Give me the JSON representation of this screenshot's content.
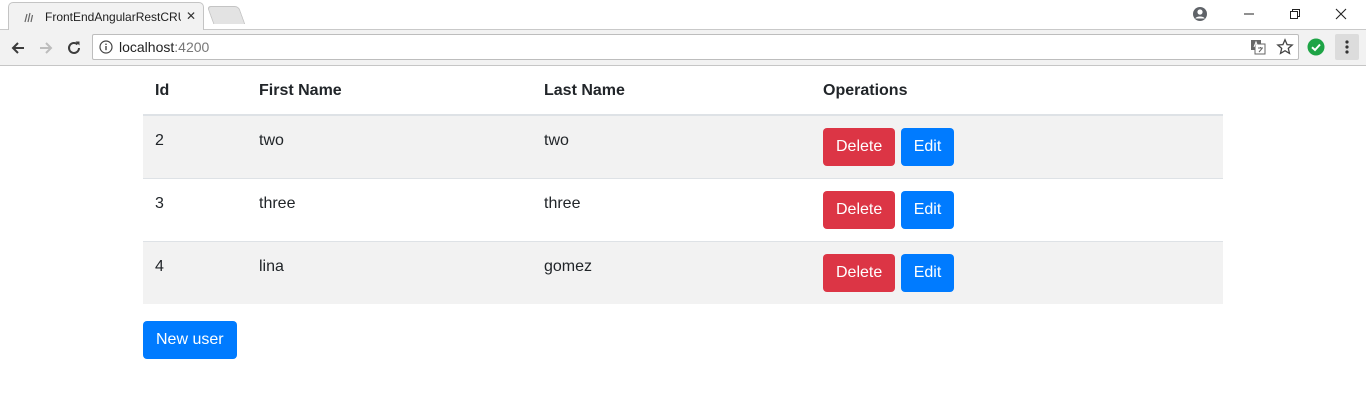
{
  "browser": {
    "tab_title": "FrontEndAngularRestCRUD",
    "tab_close": "✕",
    "url_host": "localhost",
    "url_port": ":4200"
  },
  "table": {
    "headers": {
      "id": "Id",
      "first_name": "First Name",
      "last_name": "Last Name",
      "operations": "Operations"
    },
    "rows": [
      {
        "id": "2",
        "first_name": "two",
        "last_name": "two",
        "delete_label": "Delete",
        "edit_label": "Edit"
      },
      {
        "id": "3",
        "first_name": "three",
        "last_name": "three",
        "delete_label": "Delete",
        "edit_label": "Edit"
      },
      {
        "id": "4",
        "first_name": "lina",
        "last_name": "gomez",
        "delete_label": "Delete",
        "edit_label": "Edit"
      }
    ]
  },
  "actions": {
    "new_user_label": "New user"
  },
  "colors": {
    "danger": "#dc3545",
    "primary": "#007bff",
    "stripe": "#f2f2f2"
  }
}
